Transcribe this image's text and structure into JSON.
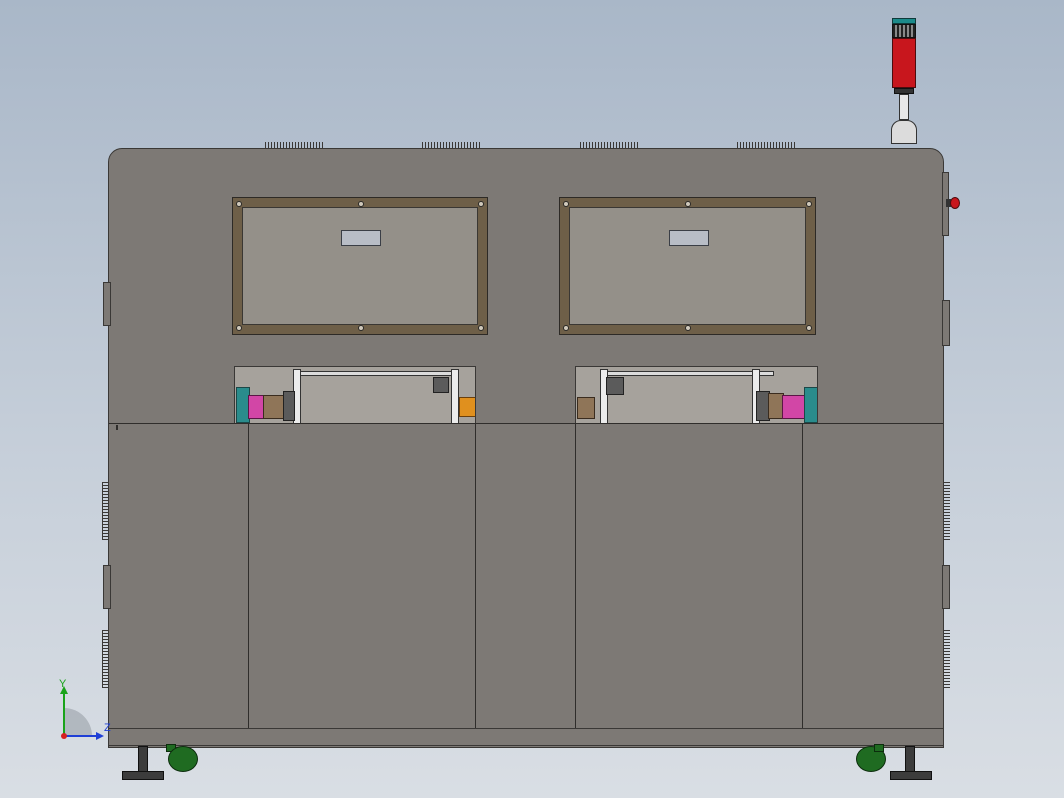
{
  "viewport": {
    "background_top": "#a9b7c8",
    "background_bottom": "#d9dee4"
  },
  "triad": {
    "y_label": "Y",
    "z_label": "Z",
    "y_color": "#1aa31a",
    "z_color": "#1f3fd6",
    "x_color": "#d61f1f"
  },
  "machine": {
    "body_color": "#7d7975",
    "window_frame_color": "#6e5f48",
    "glass_color": "#949089",
    "signal_tower_color": "#c8161d",
    "emergency_stop_color": "#c8161d",
    "caster_color": "#1f6b21",
    "icons": [
      "signal-tower-icon",
      "emergency-stop-icon",
      "caster-wheel-icon",
      "coordinate-triad-icon"
    ]
  }
}
